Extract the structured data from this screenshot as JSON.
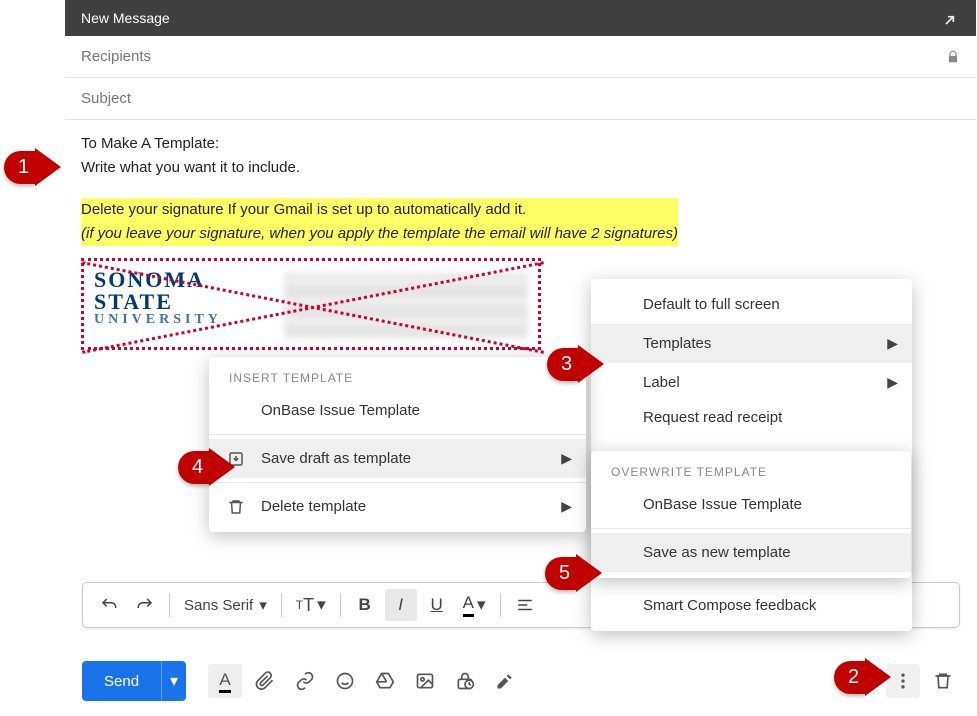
{
  "header": {
    "title": "New Message"
  },
  "fields": {
    "recipients_placeholder": "Recipients",
    "subject_placeholder": "Subject"
  },
  "body": {
    "line1": "To Make A Template:",
    "line2": "Write what you want it to include.",
    "highlight_line1": "Delete your signature If your Gmail is set up to automatically add it.",
    "highlight_line2": "(if you leave your signature, when you apply the template the email will have 2 signatures)"
  },
  "signature": {
    "line1": "SONOMA",
    "line2": "STATE",
    "line3": "UNIVERSITY"
  },
  "format_toolbar": {
    "font": "Sans Serif"
  },
  "bottom_toolbar": {
    "send": "Send"
  },
  "menus": {
    "templates": {
      "heading": "INSERT TEMPLATE",
      "item1": "OnBase Issue Template",
      "item2": "Save draft as template",
      "item3": "Delete template"
    },
    "moreopts": {
      "item1": "Default to full screen",
      "item2": "Templates",
      "item3": "Label",
      "item4": "Request read receipt",
      "item5": "Smart Compose feedback"
    },
    "overwrite": {
      "heading": "OVERWRITE TEMPLATE",
      "item1": "OnBase Issue Template",
      "item2": "Save as new template"
    }
  },
  "callouts": {
    "c1": "1",
    "c2": "2",
    "c3": "3",
    "c4": "4",
    "c5": "5"
  }
}
